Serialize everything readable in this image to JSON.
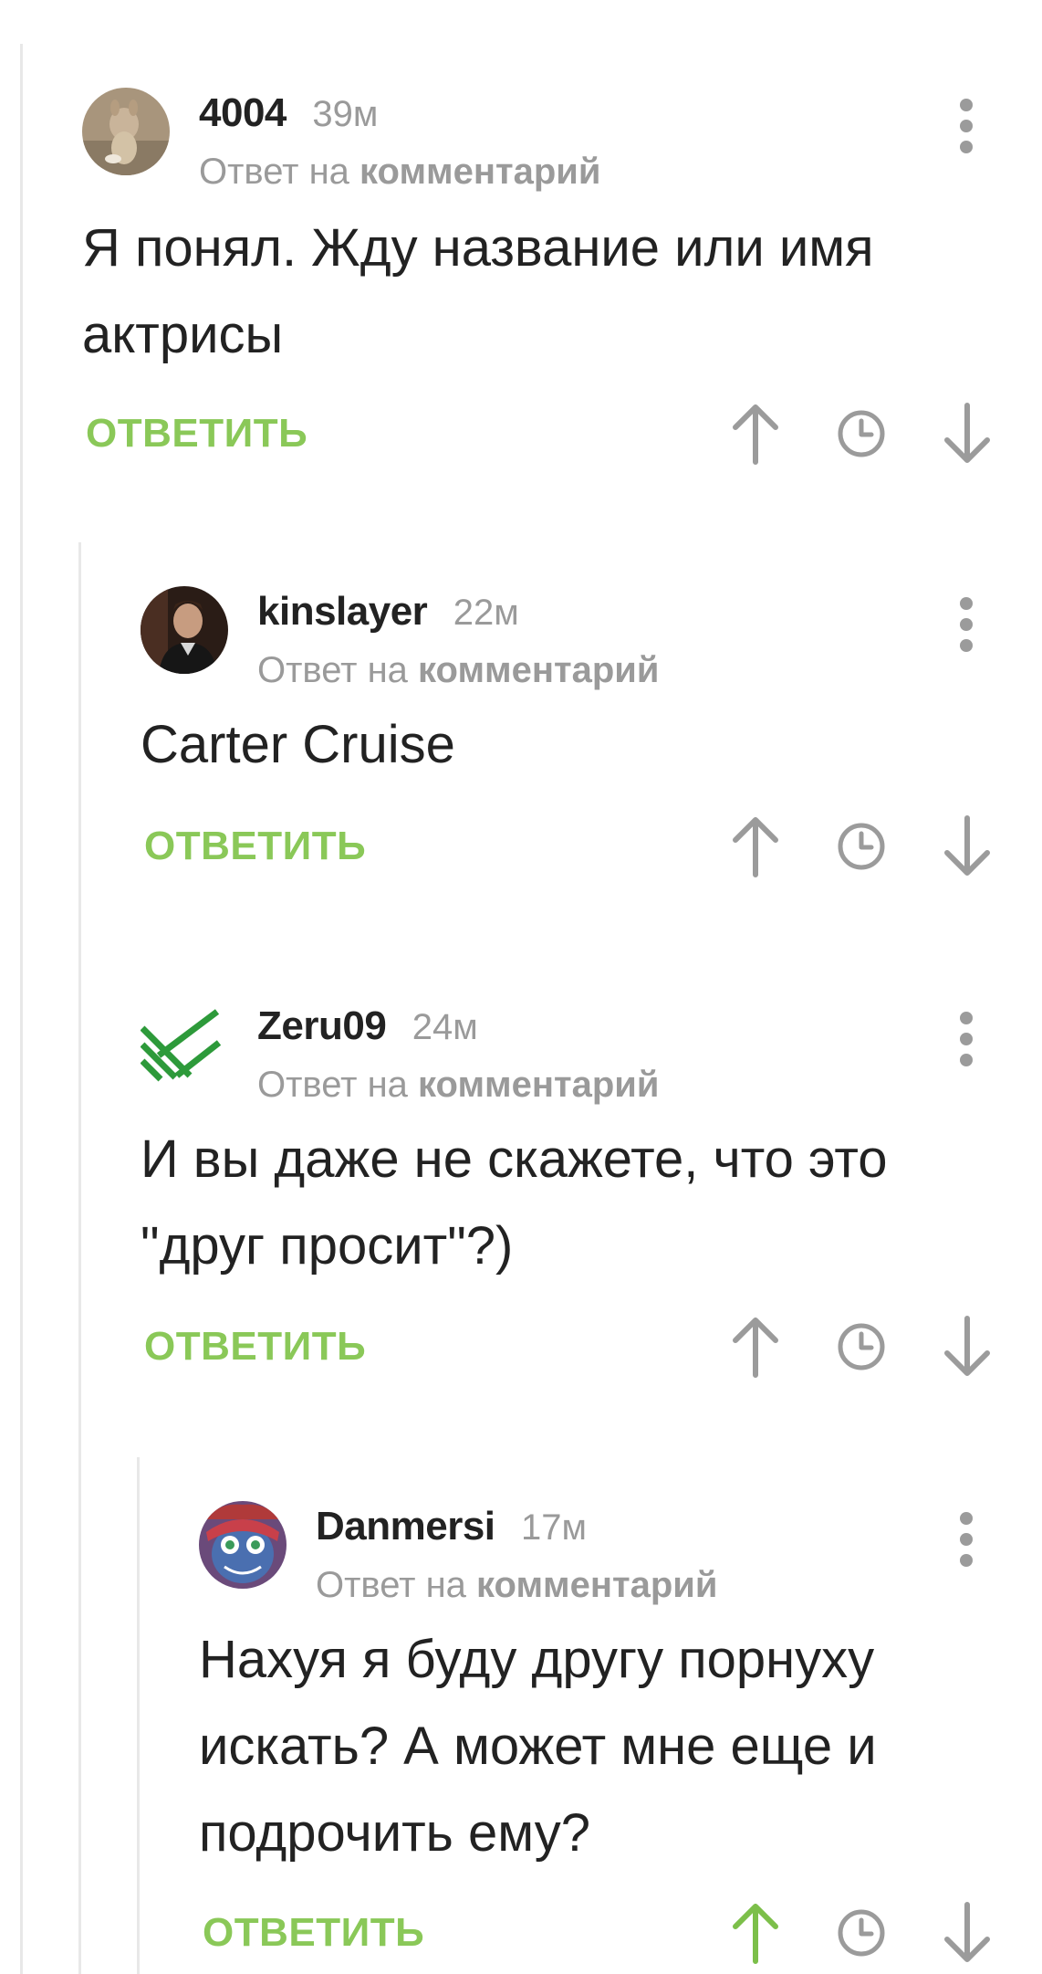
{
  "comments": [
    {
      "username": "4004",
      "time": "39м",
      "reply_prefix": "Ответ на",
      "reply_target": "комментарий",
      "text_lines": [
        "Я понял. Жду название или имя",
        "актрисы"
      ],
      "reply_label": "ОТВЕТИТЬ",
      "upvoted": false
    },
    {
      "username": "kinslayer",
      "time": "22м",
      "reply_prefix": "Ответ на",
      "reply_target": "комментарий",
      "text_lines": [
        "Carter Cruise"
      ],
      "reply_label": "ОТВЕТИТЬ",
      "upvoted": false
    },
    {
      "username": "Zeru09",
      "time": "24м",
      "reply_prefix": "Ответ на",
      "reply_target": "комментарий",
      "text_lines": [
        "И вы даже не скажете, что это",
        "\"друг просит\"?)"
      ],
      "reply_label": "ОТВЕТИТЬ",
      "upvoted": false
    },
    {
      "username": "Danmersi",
      "time": "17м",
      "reply_prefix": "Ответ на",
      "reply_target": "комментарий",
      "text_lines": [
        "Нахуя я буду другу порнуху",
        "искать? А может мне еще и",
        "подрочить ему?"
      ],
      "reply_label": "ОТВЕТИТЬ",
      "upvoted": true
    }
  ],
  "icons": {
    "upvote": "arrow-up-icon",
    "time": "clock-icon",
    "downvote": "arrow-down-icon",
    "more": "more-vertical-icon"
  },
  "colors": {
    "accent_green": "#8ac858",
    "upvote_active": "#7cbf4a",
    "icon_gray": "#9b9b9b",
    "meta_gray": "#9a9a9a"
  }
}
